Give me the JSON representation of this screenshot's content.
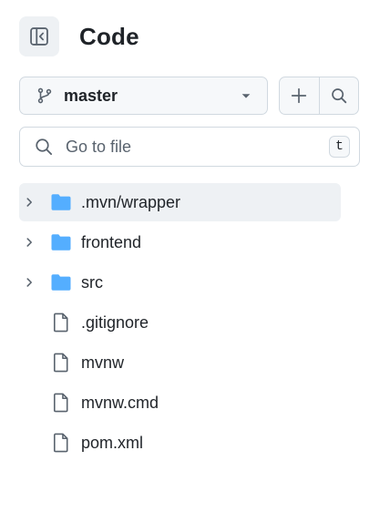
{
  "header": {
    "title": "Code",
    "toggle_icon": "sidebar-collapse-icon"
  },
  "branch": {
    "name": "master",
    "icon": "git-branch-icon",
    "dropdown_icon": "caret-down-icon",
    "add_icon": "plus-icon",
    "search_icon": "search-icon"
  },
  "search": {
    "placeholder": "Go to file",
    "value": "",
    "shortcut": "t"
  },
  "tree": {
    "items": [
      {
        "name": ".mvn/wrapper",
        "type": "folder",
        "expandable": true,
        "selected": true
      },
      {
        "name": "frontend",
        "type": "folder",
        "expandable": true,
        "selected": false
      },
      {
        "name": "src",
        "type": "folder",
        "expandable": true,
        "selected": false
      },
      {
        "name": ".gitignore",
        "type": "file",
        "expandable": false,
        "selected": false
      },
      {
        "name": "mvnw",
        "type": "file",
        "expandable": false,
        "selected": false
      },
      {
        "name": "mvnw.cmd",
        "type": "file",
        "expandable": false,
        "selected": false
      },
      {
        "name": "pom.xml",
        "type": "file",
        "expandable": false,
        "selected": false
      }
    ]
  },
  "colors": {
    "folder": "#54aeff",
    "icon": "#59636e",
    "selected_row": "#eef1f4"
  }
}
